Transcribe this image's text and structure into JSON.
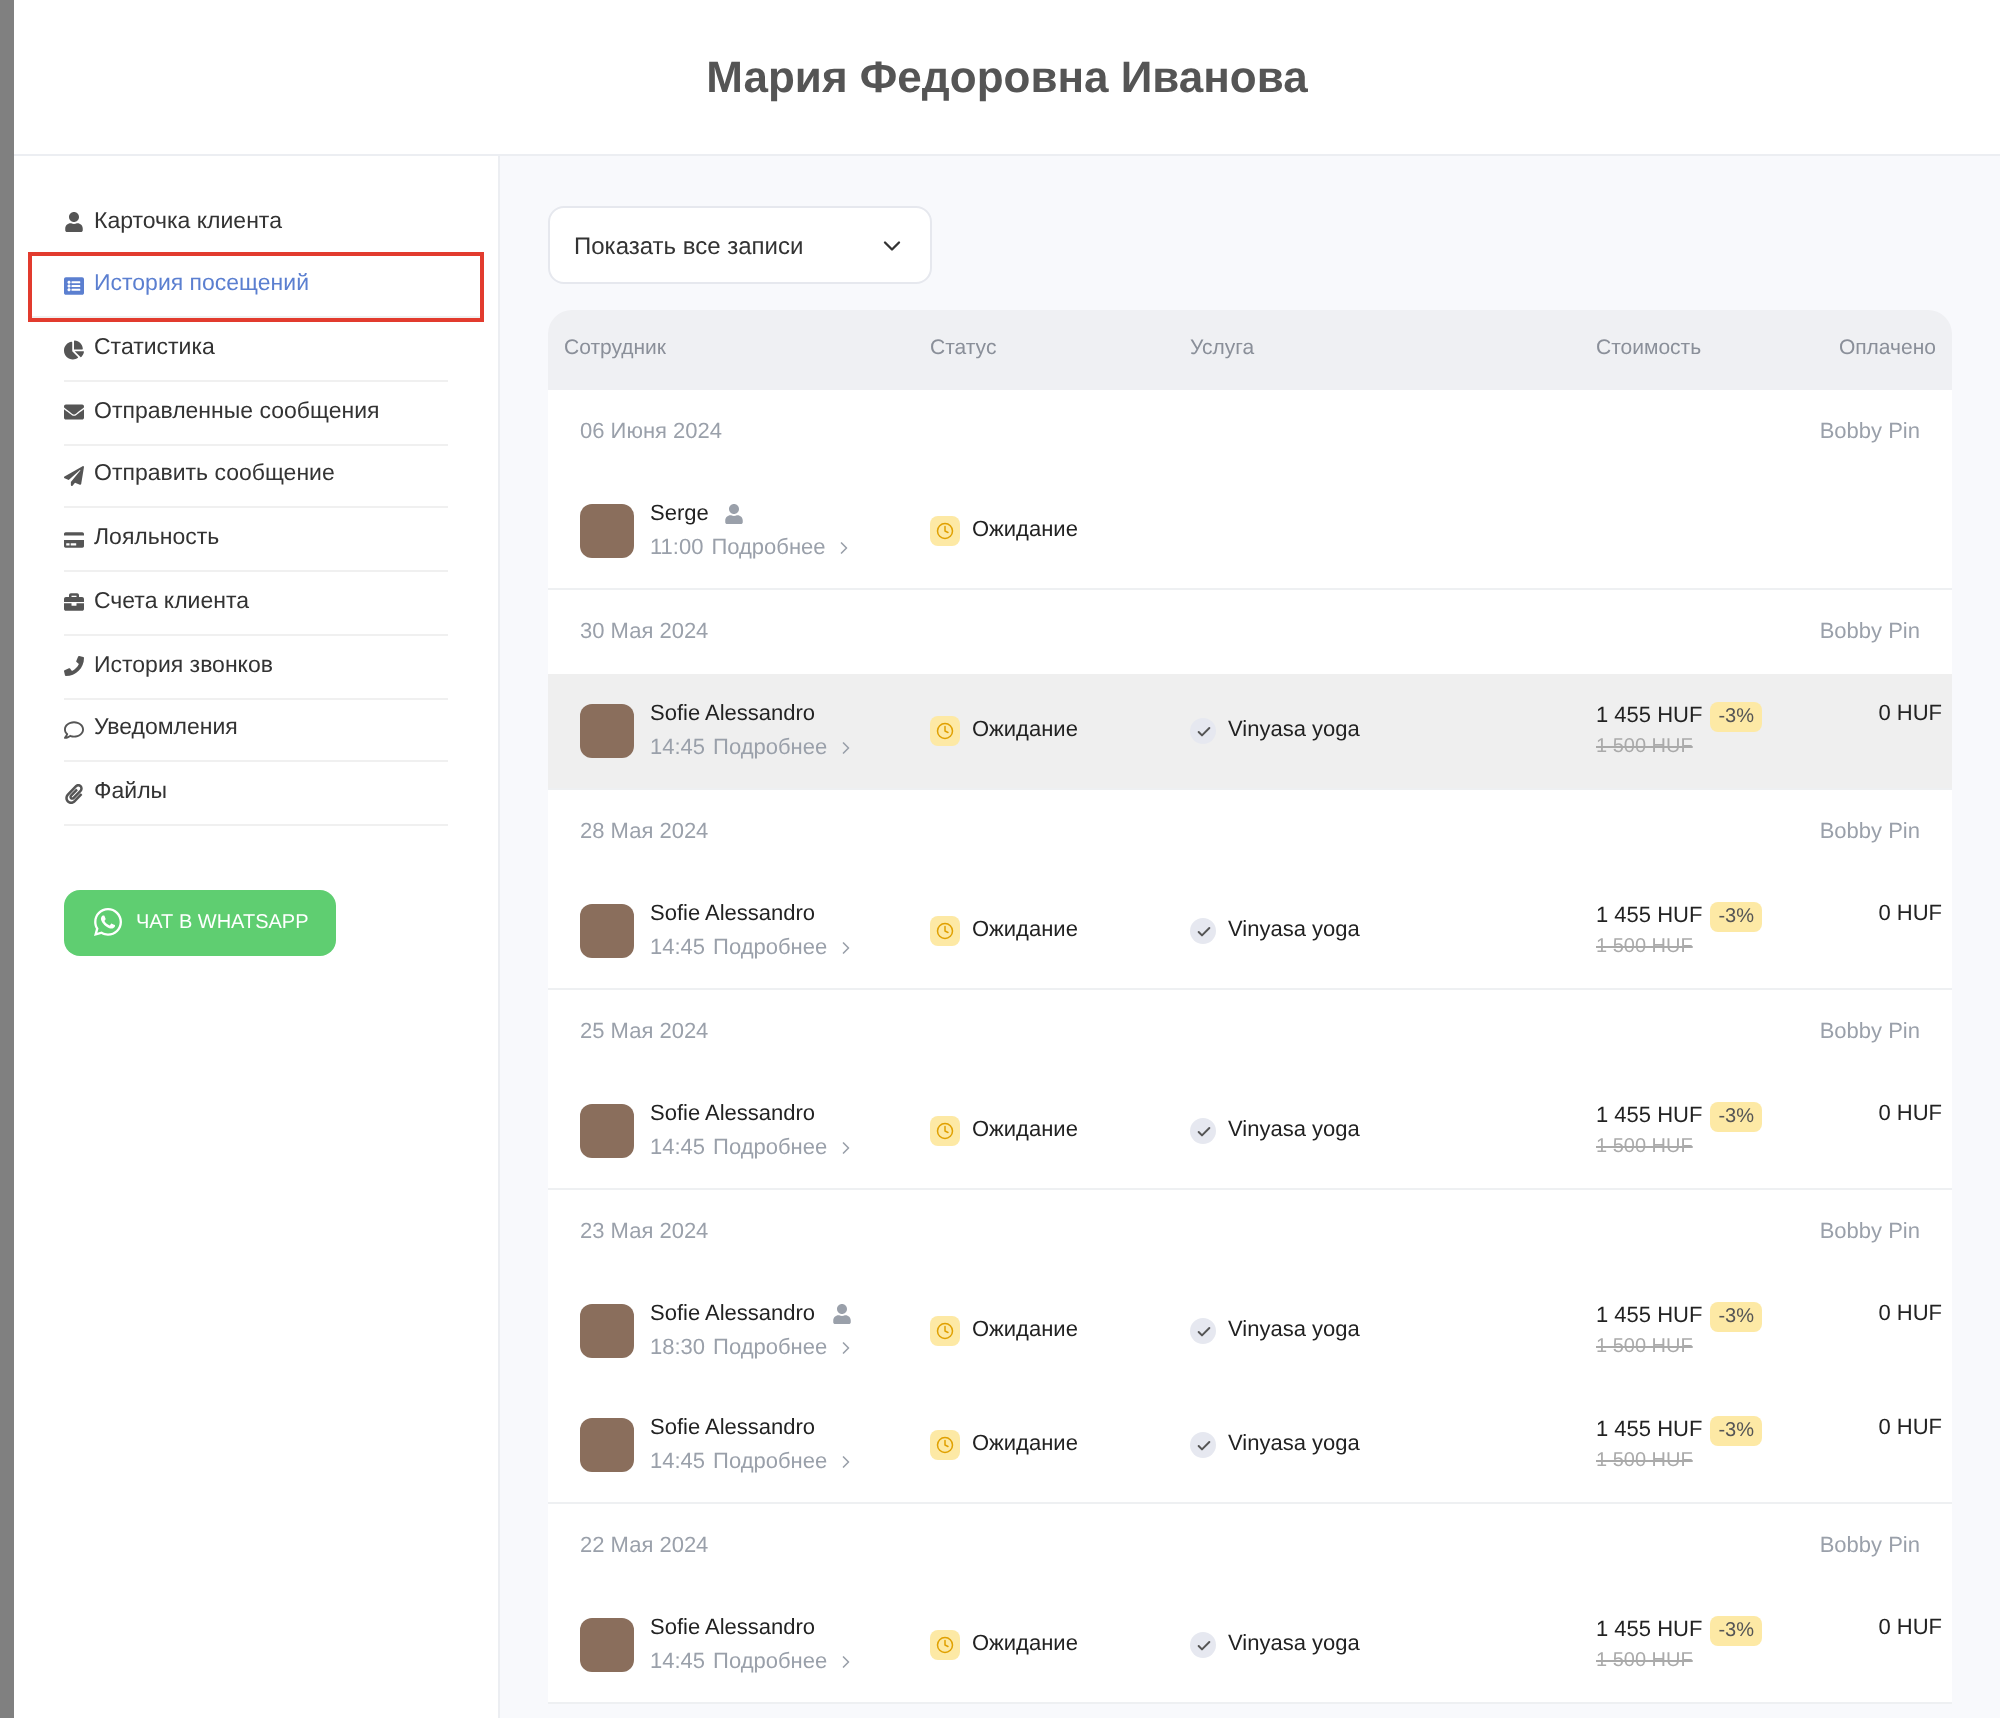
{
  "title": "Мария Федоровна Иванова",
  "sidebar": {
    "items": [
      {
        "label": "Карточка клиента",
        "selected": false
      },
      {
        "label": "История посещений",
        "selected": true
      },
      {
        "label": "Статистика",
        "selected": false
      },
      {
        "label": "Отправленные сообщения",
        "selected": false
      },
      {
        "label": "Отправить сообщение",
        "selected": false
      },
      {
        "label": "Лояльность",
        "selected": false
      },
      {
        "label": "Счета клиента",
        "selected": false
      },
      {
        "label": "История звонков",
        "selected": false
      },
      {
        "label": "Уведомления",
        "selected": false
      },
      {
        "label": "Файлы",
        "selected": false
      }
    ],
    "whatsapp_button": "ЧАТ В WHATSAPP"
  },
  "filter": {
    "value": "Показать все записи"
  },
  "table": {
    "columns": [
      "Сотрудник",
      "Статус",
      "Услуга",
      "Стоимость",
      "Оплачено"
    ],
    "groups": [
      {
        "date": "06 Июня 2024",
        "master": "Bobby Pin",
        "visits": [
          {
            "name": "Serge",
            "client_icon": true,
            "time": "11:00",
            "more": "Подробнее",
            "status": "Ожидание",
            "hovered": false
          }
        ]
      },
      {
        "date": "30 Мая 2024",
        "master": "Bobby Pin",
        "visits": [
          {
            "name": "Sofie Alessandro",
            "client_icon": false,
            "time": "14:45",
            "more": "Подробнее",
            "status": "Ожидание",
            "service": "Vinyasa yoga",
            "price": "1 455 HUF",
            "discount": "-3%",
            "old_price": "1 500 HUF",
            "paid": "0 HUF",
            "hovered": true
          }
        ]
      },
      {
        "date": "28 Мая 2024",
        "master": "Bobby Pin",
        "visits": [
          {
            "name": "Sofie Alessandro",
            "client_icon": false,
            "time": "14:45",
            "more": "Подробнее",
            "status": "Ожидание",
            "service": "Vinyasa yoga",
            "price": "1 455 HUF",
            "discount": "-3%",
            "old_price": "1 500 HUF",
            "paid": "0 HUF",
            "hovered": false
          }
        ]
      },
      {
        "date": "25 Мая 2024",
        "master": "Bobby Pin",
        "visits": [
          {
            "name": "Sofie Alessandro",
            "client_icon": false,
            "time": "14:45",
            "more": "Подробнее",
            "status": "Ожидание",
            "service": "Vinyasa yoga",
            "price": "1 455 HUF",
            "discount": "-3%",
            "old_price": "1 500 HUF",
            "paid": "0 HUF",
            "hovered": false
          }
        ]
      },
      {
        "date": "23 Мая 2024",
        "master": "Bobby Pin",
        "visits": [
          {
            "name": "Sofie Alessandro",
            "client_icon": true,
            "time": "18:30",
            "more": "Подробнее",
            "status": "Ожидание",
            "service": "Vinyasa yoga",
            "price": "1 455 HUF",
            "discount": "-3%",
            "old_price": "1 500 HUF",
            "paid": "0 HUF",
            "hovered": false
          },
          {
            "name": "Sofie Alessandro",
            "client_icon": false,
            "time": "14:45",
            "more": "Подробнее",
            "status": "Ожидание",
            "service": "Vinyasa yoga",
            "price": "1 455 HUF",
            "discount": "-3%",
            "old_price": "1 500 HUF",
            "paid": "0 HUF",
            "hovered": false
          }
        ]
      },
      {
        "date": "22 Мая 2024",
        "master": "Bobby Pin",
        "visits": [
          {
            "name": "Sofie Alessandro",
            "client_icon": false,
            "time": "14:45",
            "more": "Подробнее",
            "status": "Ожидание",
            "service": "Vinyasa yoga",
            "price": "1 455 HUF",
            "discount": "-3%",
            "old_price": "1 500 HUF",
            "paid": "0 HUF",
            "hovered": false
          }
        ]
      }
    ]
  }
}
